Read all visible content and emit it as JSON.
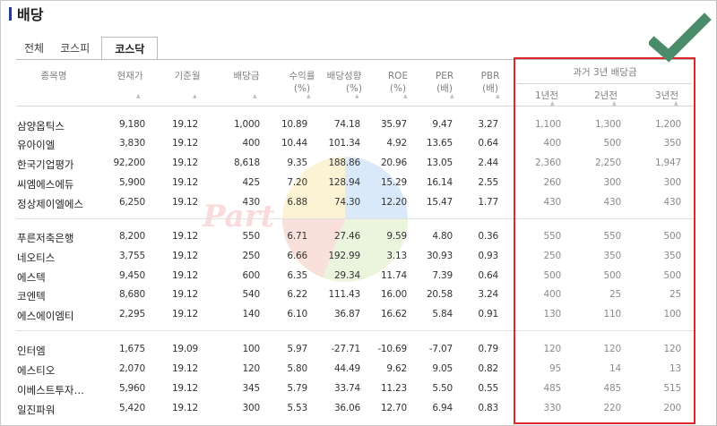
{
  "page": {
    "title": "배당"
  },
  "tabs": [
    {
      "label": "전체"
    },
    {
      "label": "코스피"
    },
    {
      "label": "코스닥"
    }
  ],
  "columns": {
    "name": "종목명",
    "price": "현재가",
    "base": "기준월",
    "dividend": "배당금",
    "yield_l1": "수익률",
    "yield_l2": "(%)",
    "payout_l1": "배당성향",
    "payout_l2": "(%)",
    "roe_l1": "ROE",
    "roe_l2": "(%)",
    "per_l1": "PER",
    "per_l2": "(배)",
    "pbr_l1": "PBR",
    "pbr_l2": "(배)",
    "past_title": "과거 3년 배당금",
    "past_1": "1년전",
    "past_2": "2년전",
    "past_3": "3년전"
  },
  "sort_glyph": "▲",
  "rows": [
    [
      "삼양옵틱스",
      "9,180",
      "19.12",
      "1,000",
      "10.89",
      "74.18",
      "35.97",
      "9.47",
      "3.27",
      "1,100",
      "1,300",
      "1,200"
    ],
    [
      "유아이엘",
      "3,830",
      "19.12",
      "400",
      "10.44",
      "101.34",
      "4.92",
      "13.65",
      "0.64",
      "400",
      "500",
      "350"
    ],
    [
      "한국기업평가",
      "92,200",
      "19.12",
      "8,618",
      "9.35",
      "188.86",
      "20.96",
      "13.05",
      "2.44",
      "2,360",
      "2,250",
      "1,947"
    ],
    [
      "씨엠에스에듀",
      "5,900",
      "19.12",
      "425",
      "7.20",
      "128.94",
      "15.29",
      "16.14",
      "2.55",
      "260",
      "300",
      "300"
    ],
    [
      "정상제이엘에스",
      "6,250",
      "19.12",
      "430",
      "6.88",
      "74.30",
      "12.20",
      "15.47",
      "1.77",
      "430",
      "430",
      "430"
    ],
    [
      "푸른저축은행",
      "8,200",
      "19.12",
      "550",
      "6.71",
      "27.46",
      "9.59",
      "4.80",
      "0.36",
      "550",
      "550",
      "500"
    ],
    [
      "네오티스",
      "3,755",
      "19.12",
      "250",
      "6.66",
      "192.99",
      "3.13",
      "30.93",
      "0.93",
      "250",
      "350",
      "350"
    ],
    [
      "에스텍",
      "9,450",
      "19.12",
      "600",
      "6.35",
      "29.34",
      "11.74",
      "7.39",
      "0.64",
      "500",
      "500",
      "500"
    ],
    [
      "코엔텍",
      "8,680",
      "19.12",
      "540",
      "6.22",
      "111.43",
      "16.00",
      "20.58",
      "3.24",
      "400",
      "25",
      "25"
    ],
    [
      "에스에이엠티",
      "2,295",
      "19.12",
      "140",
      "6.10",
      "36.87",
      "16.62",
      "5.84",
      "0.91",
      "130",
      "110",
      "100"
    ],
    [
      "인터엠",
      "1,675",
      "19.09",
      "100",
      "5.97",
      "-27.71",
      "-10.69",
      "-7.07",
      "0.79",
      "120",
      "120",
      "120"
    ],
    [
      "에스티오",
      "2,070",
      "19.12",
      "120",
      "5.80",
      "44.49",
      "9.62",
      "9.05",
      "0.82",
      "95",
      "14",
      "13"
    ],
    [
      "이베스트투자…",
      "5,960",
      "19.12",
      "345",
      "5.79",
      "33.74",
      "11.23",
      "5.50",
      "0.55",
      "485",
      "485",
      "515"
    ],
    [
      "일진파워",
      "5,420",
      "19.12",
      "300",
      "5.53",
      "36.06",
      "12.70",
      "6.94",
      "0.83",
      "330",
      "220",
      "200"
    ]
  ],
  "watermark": {
    "text": "Part"
  },
  "colors": {
    "accent": "#2b3a8e",
    "highlight_box": "#e0262b",
    "check": "#4a8c6a"
  }
}
